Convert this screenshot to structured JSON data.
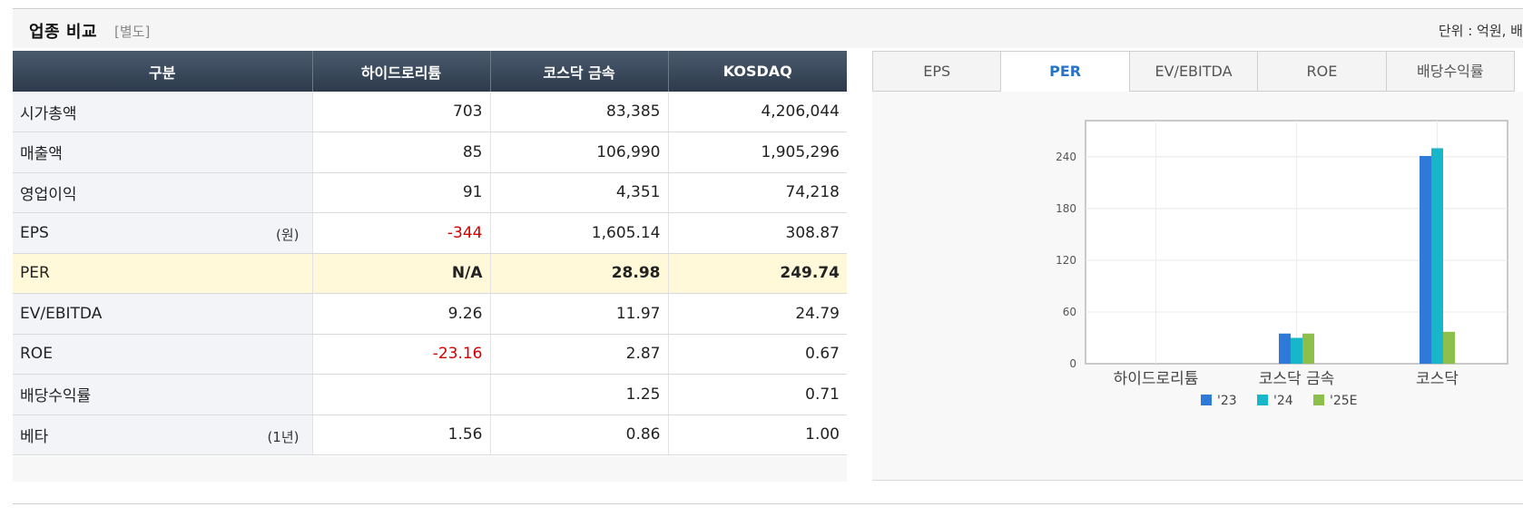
{
  "header": {
    "title": "업종 비교",
    "subtitle": "[별도]",
    "unit": "단위 : 억원, 배"
  },
  "table": {
    "columns": [
      "구분",
      "하이드로리튬",
      "코스닥 금속",
      "KOSDAQ"
    ],
    "rows": [
      {
        "label": "시가총액",
        "unit": "",
        "values": [
          "703",
          "83,385",
          "4,206,044"
        ]
      },
      {
        "label": "매출액",
        "unit": "",
        "values": [
          "85",
          "106,990",
          "1,905,296"
        ]
      },
      {
        "label": "영업이익",
        "unit": "",
        "values": [
          "91",
          "4,351",
          "74,218"
        ]
      },
      {
        "label": "EPS",
        "unit": "(원)",
        "values": [
          "-344",
          "1,605.14",
          "308.87"
        ]
      },
      {
        "label": "PER",
        "unit": "",
        "values": [
          "N/A",
          "28.98",
          "249.74"
        ]
      },
      {
        "label": "EV/EBITDA",
        "unit": "",
        "values": [
          "9.26",
          "11.97",
          "24.79"
        ]
      },
      {
        "label": "ROE",
        "unit": "",
        "values": [
          "-23.16",
          "2.87",
          "0.67"
        ]
      },
      {
        "label": "배당수익률",
        "unit": "",
        "values": [
          "",
          "1.25",
          "0.71"
        ]
      },
      {
        "label": "베타",
        "unit": "(1년)",
        "values": [
          "1.56",
          "0.86",
          "1.00"
        ]
      }
    ],
    "highlight_row": "PER",
    "negative_color": "#d40000",
    "highlight_color": "#fff9d9"
  },
  "tabs": {
    "items": [
      "EPS",
      "PER",
      "EV/EBITDA",
      "ROE",
      "배당수익률"
    ],
    "active": "PER",
    "active_color": "#2a74c8"
  },
  "chart_data": {
    "type": "bar",
    "categories": [
      "하이드로리튬",
      "코스닥  금속",
      "코스닥"
    ],
    "series": [
      {
        "name": "'23",
        "color": "#2f79d8",
        "values": [
          null,
          35,
          241
        ]
      },
      {
        "name": "'24",
        "color": "#17b7c9",
        "values": [
          null,
          30,
          250
        ]
      },
      {
        "name": "'25E",
        "color": "#8cc04a",
        "values": [
          null,
          35,
          37
        ]
      }
    ],
    "y_ticks": [
      0,
      60,
      120,
      180,
      240
    ],
    "ylim": [
      0,
      282
    ],
    "grid": true,
    "legend_position": "bottom"
  }
}
